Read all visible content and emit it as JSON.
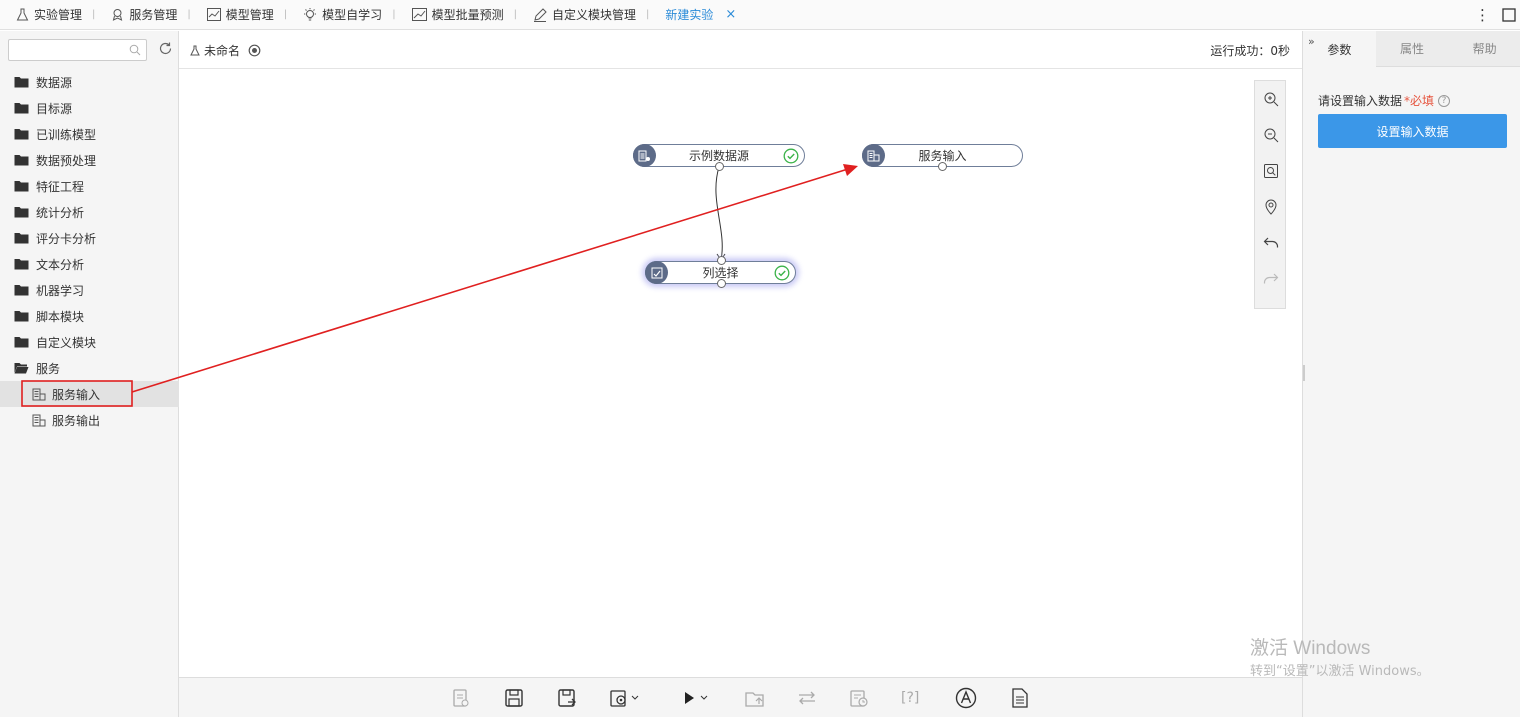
{
  "topnav": {
    "items": [
      {
        "label": "实验管理",
        "icon": "flask-icon"
      },
      {
        "label": "服务管理",
        "icon": "service-icon"
      },
      {
        "label": "模型管理",
        "icon": "chart-icon"
      },
      {
        "label": "模型自学习",
        "icon": "bulb-icon"
      },
      {
        "label": "模型批量预测",
        "icon": "trend-icon"
      },
      {
        "label": "自定义模块管理",
        "icon": "edit-icon"
      }
    ],
    "active_tab": "新建实验",
    "close_glyph": "×",
    "more_glyph": "⋮"
  },
  "sidebar": {
    "search_placeholder": "",
    "folders": [
      "数据源",
      "目标源",
      "已训练模型",
      "数据预处理",
      "特征工程",
      "统计分析",
      "评分卡分析",
      "文本分析",
      "机器学习",
      "脚本模块",
      "自定义模块",
      "服务"
    ],
    "service_children": [
      {
        "label": "服务输入",
        "selected": true
      },
      {
        "label": "服务输出",
        "selected": false
      }
    ]
  },
  "canvas_header": {
    "experiment_name": "未命名",
    "run_status": "运行成功：0秒"
  },
  "nodes": {
    "sample_source": {
      "label": "示例数据源",
      "status": "success"
    },
    "service_input": {
      "label": "服务输入"
    },
    "column_select": {
      "label": "列选择",
      "status": "success"
    }
  },
  "right_panel": {
    "collapse_glyph": "»",
    "tabs": [
      "参数",
      "属性",
      "帮助"
    ],
    "active_tab": "参数",
    "field_label": "请设置输入数据",
    "required_mark": "*必填",
    "help_glyph": "?",
    "button_label": "设置输入数据"
  },
  "watermark": {
    "line1": "激活 Windows",
    "line2": "转到“设置”以激活 Windows。"
  },
  "colors": {
    "accent": "#3b97e8",
    "link_blue": "#2b8bd8",
    "annotation_red": "#e02020",
    "node_icon_bg": "#5d6b88",
    "success_green": "#3cb34a"
  }
}
